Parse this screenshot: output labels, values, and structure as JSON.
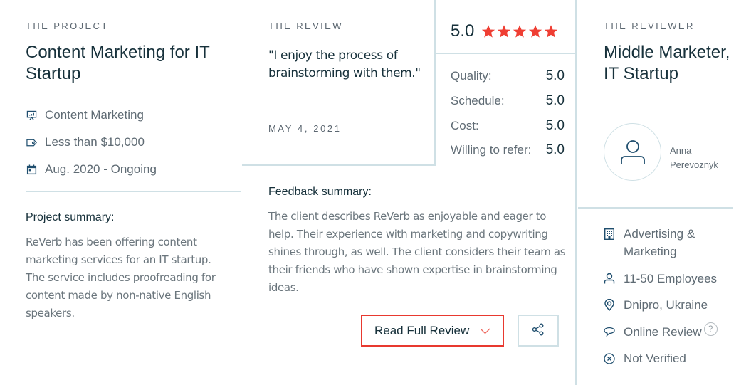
{
  "project": {
    "eyebrow": "THE PROJECT",
    "title": "Content Marketing for IT Startup",
    "meta": [
      {
        "icon": "presentation-chart-icon",
        "text": "Content Marketing"
      },
      {
        "icon": "price-tag-icon",
        "text": "Less than $10,000"
      },
      {
        "icon": "calendar-icon",
        "text": "Aug. 2020 - Ongoing"
      }
    ],
    "summary_heading": "Project summary:",
    "summary_text": "ReVerb has been offering content marketing services for an IT startup. The service includes proofreading for content made by non-native English speakers."
  },
  "review": {
    "eyebrow": "THE REVIEW",
    "quote": "\"I enjoy the process of brainstorming with them.\"",
    "date": "MAY 4, 2021",
    "overall_rating": "5.0",
    "stars": 5,
    "star_color": "#ef3e33",
    "scores": [
      {
        "label": "Quality:",
        "value": "5.0"
      },
      {
        "label": "Schedule:",
        "value": "5.0"
      },
      {
        "label": "Cost:",
        "value": "5.0"
      },
      {
        "label": "Willing to refer:",
        "value": "5.0"
      }
    ],
    "feedback_heading": "Feedback summary:",
    "feedback_text": "The client describes ReVerb as enjoyable and eager to help. Their experience with marketing and copywriting shines through, as well. The client considers their team as their friends who have shown expertise in brainstorming ideas.",
    "read_full_label": "Read Full Review",
    "accent_color": "#e8392f"
  },
  "reviewer": {
    "eyebrow": "THE REVIEWER",
    "title": "Middle Marketer, IT Startup",
    "name": "Anna Perevoznyk",
    "details": [
      {
        "icon": "building-icon",
        "text": "Advertising & Marketing"
      },
      {
        "icon": "person-icon",
        "text": "11-50 Employees"
      },
      {
        "icon": "location-pin-icon",
        "text": "Dnipro, Ukraine"
      },
      {
        "icon": "speech-bubble-icon",
        "text": "Online Review",
        "help": "?"
      },
      {
        "icon": "x-circle-icon",
        "text": "Not Verified"
      }
    ]
  }
}
